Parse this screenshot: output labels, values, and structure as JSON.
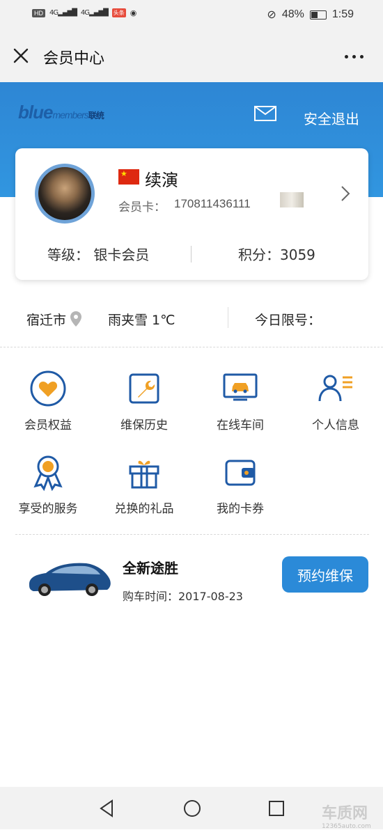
{
  "status_bar": {
    "hd": "HD",
    "sig1": "4G",
    "sig2": "4G",
    "battery": "48%",
    "time": "1:59"
  },
  "titlebar": {
    "title": "会员中心"
  },
  "header": {
    "logo_main": "blue",
    "logo_sub": "members",
    "logo_cn": "联统",
    "logout": "安全退出"
  },
  "card": {
    "name": "续演",
    "card_label": "会员卡：",
    "card_number": "170811436111",
    "level": "等级：  银卡会员",
    "points": "积分：3059"
  },
  "weather": {
    "city": "宿迁市",
    "condition": "雨夹雪  1℃",
    "limit_label": "今日限号："
  },
  "grid": [
    {
      "label": "会员权益",
      "icon": "heart-icon"
    },
    {
      "label": "维保历史",
      "icon": "wrench-icon"
    },
    {
      "label": "在线车间",
      "icon": "monitor-car-icon"
    },
    {
      "label": "个人信息",
      "icon": "person-icon"
    },
    {
      "label": "享受的服务",
      "icon": "ribbon-icon"
    },
    {
      "label": "兑换的礼品",
      "icon": "gift-icon"
    },
    {
      "label": "我的卡券",
      "icon": "wallet-icon"
    }
  ],
  "car": {
    "name": "全新途胜",
    "purchase": "购车时间：2017-08-23",
    "button": "预约维保"
  },
  "watermark": {
    "main": "车质网",
    "sub": "12365auto.com"
  },
  "colors": {
    "primary": "#2b8ad8",
    "icon_blue": "#1f5aa6",
    "icon_orange": "#f0a024"
  }
}
